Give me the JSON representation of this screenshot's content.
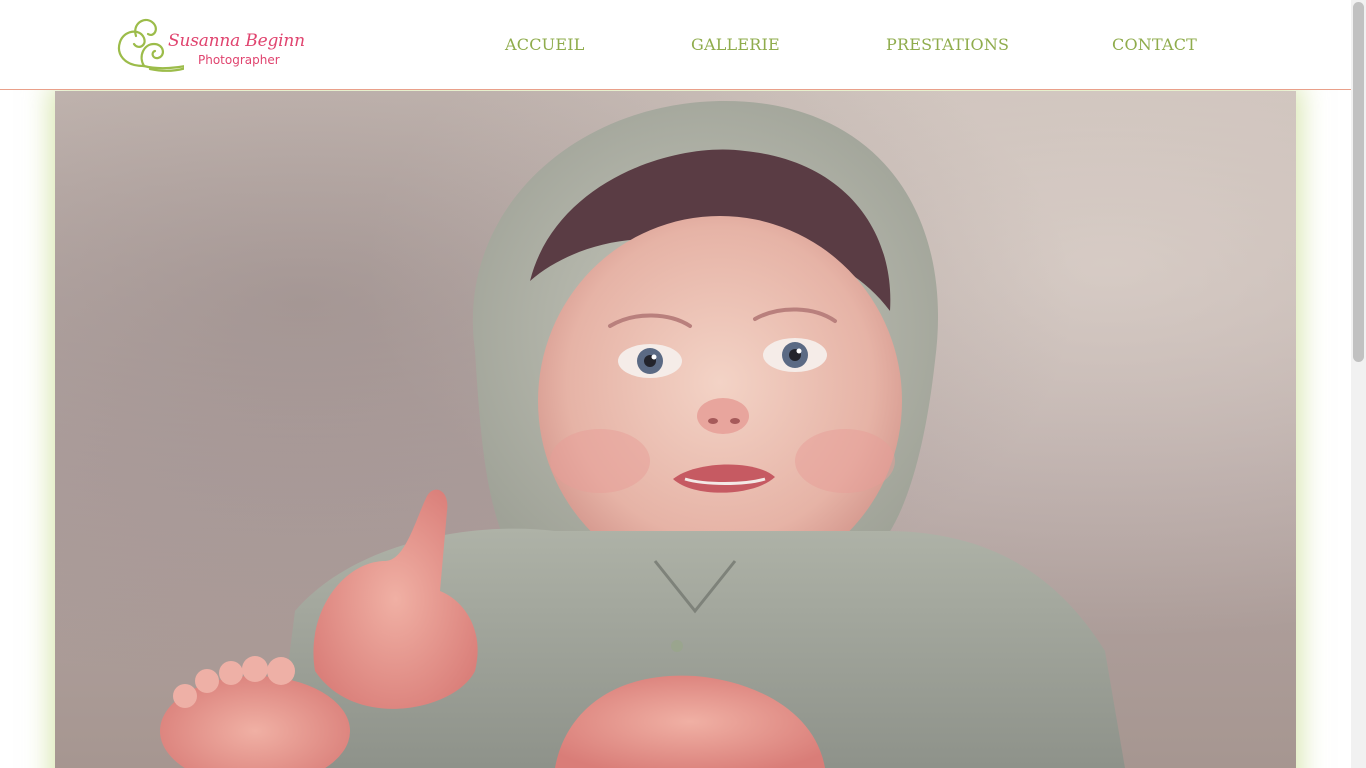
{
  "brand": {
    "name": "Susanna Beginn",
    "tagline": "Photographer",
    "colors": {
      "name": "#e0446f",
      "swirl": "#9cbc4a"
    }
  },
  "nav": {
    "items": [
      {
        "label": "ACCUEIL"
      },
      {
        "label": "GALLERIE"
      },
      {
        "label": "PRESTATIONS"
      },
      {
        "label": "CONTACT"
      }
    ],
    "color": "#8fac4c"
  },
  "hero": {
    "image": "baby-in-knitted-hood-photo"
  },
  "theme": {
    "header_border": "#e9a08a",
    "hero_glow": "#bed678"
  }
}
